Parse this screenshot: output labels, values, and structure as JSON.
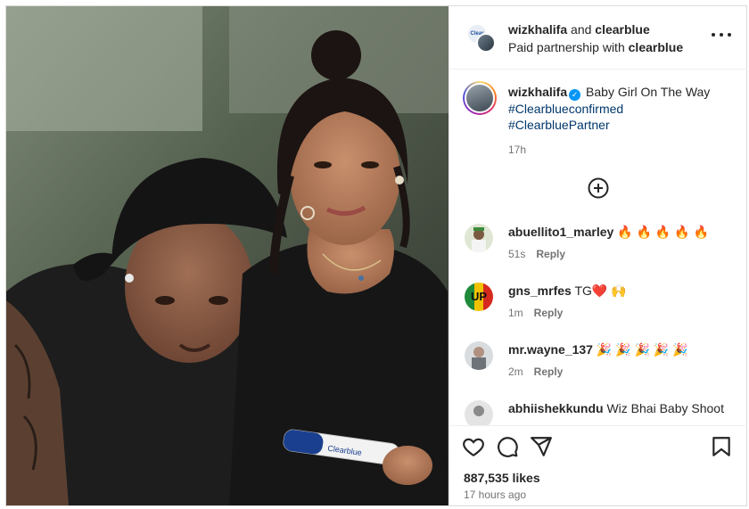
{
  "header": {
    "account1": "wizkhalifa",
    "and_text": "and",
    "account2": "clearblue",
    "partnership_prefix": "Paid partnership with",
    "partnership_brand": "clearblue",
    "brand_logo_text": "Clear"
  },
  "caption": {
    "username": "wizkhalifa",
    "text": "Baby Girl On The Way",
    "hashtags": [
      "#Clearblueconfirmed",
      "#ClearbluePartner"
    ],
    "time": "17h"
  },
  "comments": [
    {
      "username": "abuellito1_marley",
      "text": "🔥 🔥 🔥 🔥 🔥",
      "time": "51s",
      "reply": "Reply"
    },
    {
      "username": "gns_mrfes",
      "text": "TG❤️ 🙌",
      "time": "1m",
      "reply": "Reply",
      "avatar_text": "UP"
    },
    {
      "username": "mr.wayne_137",
      "text": "🎉 🎉 🎉 🎉 🎉",
      "time": "2m",
      "reply": "Reply"
    },
    {
      "username": "abhiishekkundu",
      "text": "Wiz Bhai Baby Shoot",
      "time": "",
      "reply": ""
    }
  ],
  "stats": {
    "likes": "887,535 likes",
    "posted": "17 hours ago"
  },
  "photo": {
    "test_brand": "Clearblue"
  },
  "colors": {
    "link": "#00376b",
    "verified": "#0095f6",
    "muted": "#737373",
    "border": "#dbdbdb"
  },
  "icons": [
    "more-options-icon",
    "verified-badge-icon",
    "add-comment-icon",
    "heart-icon",
    "comment-icon",
    "share-icon",
    "bookmark-icon"
  ]
}
